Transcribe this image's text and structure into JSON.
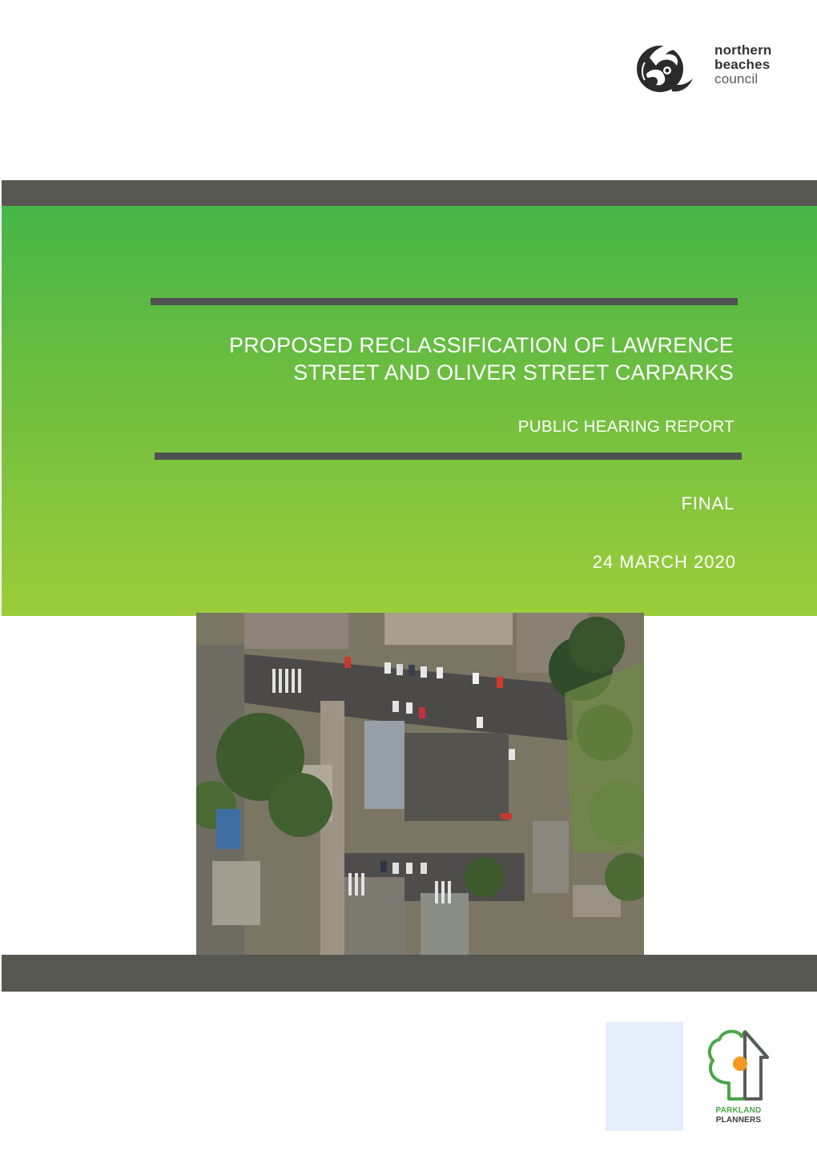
{
  "council_logo": {
    "line1": "northern",
    "line2": "beaches",
    "line3": "council",
    "icon": "northern-beaches-emblem-icon"
  },
  "report": {
    "title_line1": "PROPOSED RECLASSIFICATION OF LAWRENCE",
    "title_line2": "STREET AND OLIVER STREET CARPARKS",
    "subtitle": "PUBLIC HEARING REPORT",
    "status": "FINAL",
    "date": "24 MARCH 2020"
  },
  "colors": {
    "bar": "#575752",
    "green_top": "#46b548",
    "green_bottom": "#9ccd3a",
    "rule": "#4f5150"
  },
  "aerial_photo": {
    "icon": "aerial-carpark-photo"
  },
  "parkland_logo": {
    "line1": "PARKLAND",
    "line2": "PLANNERS",
    "icon": "parkland-planners-tree-house-icon"
  }
}
